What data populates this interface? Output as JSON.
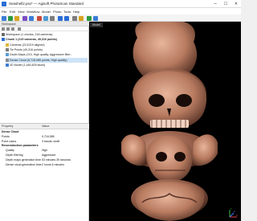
{
  "window": {
    "title": "Seashell2.psx* — Agisoft PhotoScan Standard",
    "minimize": "–",
    "maximize": "☐",
    "close": "✕"
  },
  "menu": [
    "File",
    "Edit",
    "View",
    "Workflow",
    "Model",
    "Photo",
    "Tools",
    "Help"
  ],
  "toolbar_colors": [
    "#3b7dd8",
    "#2e9a42",
    "#d9a321",
    "#7a4ec4",
    "#3b7dd8",
    "#c94a3c",
    "#4f9bd8",
    "#7d7d7d",
    "#2b6cd6",
    "#2b6cd6",
    "#7d7d7d",
    "#d9a321",
    "#2e9a42",
    "#3b7dd8"
  ],
  "workspace": {
    "header": "Workspace",
    "tree": [
      {
        "label": "Workspace (1 chunks, 218 cameras)",
        "level": 0,
        "icon": "workspace-icon",
        "color": "#6a6a6a"
      },
      {
        "label": "Chunk 1 (219 cameras, 49,316 points)",
        "level": 0,
        "icon": "chunk-icon",
        "color": "#2b6cd6",
        "bold": true
      },
      {
        "label": "Cameras (213/219 aligned)",
        "level": 1,
        "icon": "camera-icon",
        "color": "#e0b73a"
      },
      {
        "label": "Tie Points (49,316 points)",
        "level": 1,
        "icon": "tie-points-icon",
        "color": "#7a7a7a"
      },
      {
        "label": "Depth Maps (215, High quality, Aggressive filter...",
        "level": 1,
        "icon": "depth-maps-icon",
        "color": "#5a9bd5"
      },
      {
        "label": "Dense Cloud (9,718,085 points, High quality)",
        "level": 1,
        "icon": "dense-cloud-icon",
        "color": "#8a8a8a",
        "selected": true
      },
      {
        "label": "3D Model (1,484,825 faces)",
        "level": 1,
        "icon": "model-icon",
        "color": "#3a7bd5"
      }
    ]
  },
  "model": {
    "tab": "Model",
    "axes": {
      "x": "X",
      "y": "Y",
      "z": "Z"
    }
  },
  "properties": {
    "col_property": "Property",
    "col_value": "Value",
    "rows": [
      {
        "key": "Dense Cloud",
        "value": "",
        "section": true
      },
      {
        "key": "Points",
        "value": "9,718,085"
      },
      {
        "key": "Point colors",
        "value": "3 bands, uint8"
      },
      {
        "key": "Reconstruction parameters",
        "value": "",
        "section": true
      },
      {
        "key": "Quality",
        "value": "High",
        "indent": true
      },
      {
        "key": "Depth filtering",
        "value": "Aggressive",
        "indent": true
      },
      {
        "key": "Depth maps generation time",
        "value": "53 minutes 39 seconds",
        "indent": true
      },
      {
        "key": "Dense cloud generation time",
        "value": "2 hours 6 minutes",
        "indent": true
      }
    ]
  }
}
